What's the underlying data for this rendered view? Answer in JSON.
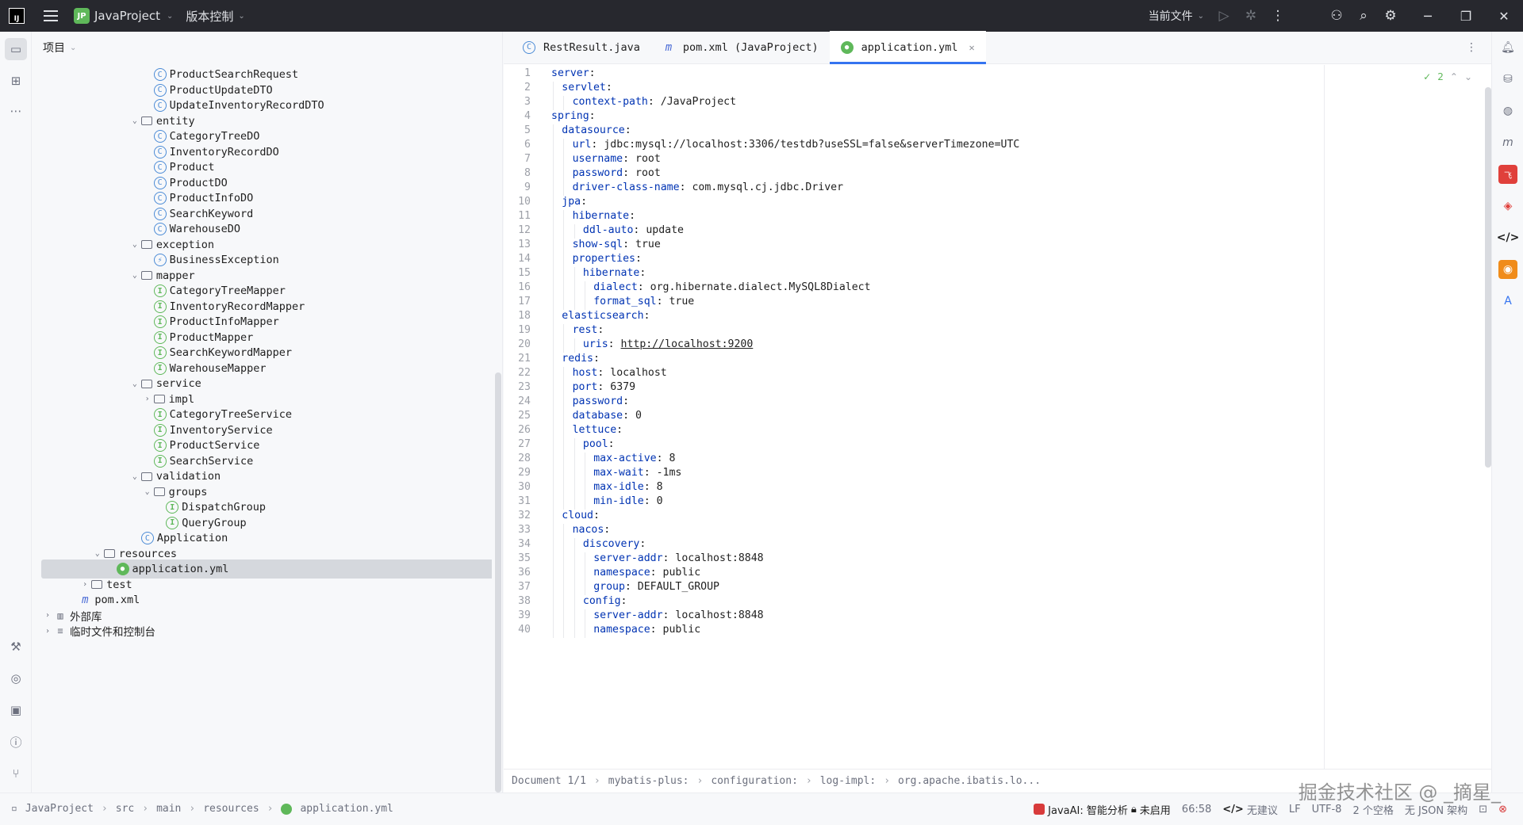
{
  "titlebar": {
    "project_badge": "JP",
    "project_name": "JavaProject",
    "vcs_label": "版本控制",
    "run_config": "当前文件"
  },
  "project_panel": {
    "header": "项目",
    "tree": [
      {
        "label": "ProductSearchRequest",
        "indent": 8,
        "icon": "class",
        "arrow": ""
      },
      {
        "label": "ProductUpdateDTO",
        "indent": 8,
        "icon": "class",
        "arrow": ""
      },
      {
        "label": "UpdateInventoryRecordDTO",
        "indent": 8,
        "icon": "class",
        "arrow": ""
      },
      {
        "label": "entity",
        "indent": 7,
        "icon": "folder",
        "arrow": "open"
      },
      {
        "label": "CategoryTreeDO",
        "indent": 8,
        "icon": "class",
        "arrow": ""
      },
      {
        "label": "InventoryRecordDO",
        "indent": 8,
        "icon": "class",
        "arrow": ""
      },
      {
        "label": "Product",
        "indent": 8,
        "icon": "class",
        "arrow": ""
      },
      {
        "label": "ProductDO",
        "indent": 8,
        "icon": "class",
        "arrow": ""
      },
      {
        "label": "ProductInfoDO",
        "indent": 8,
        "icon": "class",
        "arrow": ""
      },
      {
        "label": "SearchKeyword",
        "indent": 8,
        "icon": "class",
        "arrow": ""
      },
      {
        "label": "WarehouseDO",
        "indent": 8,
        "icon": "class",
        "arrow": ""
      },
      {
        "label": "exception",
        "indent": 7,
        "icon": "folder",
        "arrow": "open"
      },
      {
        "label": "BusinessException",
        "indent": 8,
        "icon": "exception",
        "arrow": ""
      },
      {
        "label": "mapper",
        "indent": 7,
        "icon": "folder",
        "arrow": "open"
      },
      {
        "label": "CategoryTreeMapper",
        "indent": 8,
        "icon": "interface",
        "arrow": ""
      },
      {
        "label": "InventoryRecordMapper",
        "indent": 8,
        "icon": "interface",
        "arrow": ""
      },
      {
        "label": "ProductInfoMapper",
        "indent": 8,
        "icon": "interface",
        "arrow": ""
      },
      {
        "label": "ProductMapper",
        "indent": 8,
        "icon": "interface",
        "arrow": ""
      },
      {
        "label": "SearchKeywordMapper",
        "indent": 8,
        "icon": "interface",
        "arrow": ""
      },
      {
        "label": "WarehouseMapper",
        "indent": 8,
        "icon": "interface",
        "arrow": ""
      },
      {
        "label": "service",
        "indent": 7,
        "icon": "folder",
        "arrow": "open"
      },
      {
        "label": "impl",
        "indent": 8,
        "icon": "folder",
        "arrow": "closed"
      },
      {
        "label": "CategoryTreeService",
        "indent": 8,
        "icon": "interface",
        "arrow": ""
      },
      {
        "label": "InventoryService",
        "indent": 8,
        "icon": "interface",
        "arrow": ""
      },
      {
        "label": "ProductService",
        "indent": 8,
        "icon": "interface",
        "arrow": ""
      },
      {
        "label": "SearchService",
        "indent": 8,
        "icon": "interface",
        "arrow": ""
      },
      {
        "label": "validation",
        "indent": 7,
        "icon": "folder",
        "arrow": "open"
      },
      {
        "label": "groups",
        "indent": 8,
        "icon": "folder",
        "arrow": "open"
      },
      {
        "label": "DispatchGroup",
        "indent": 9,
        "icon": "interface",
        "arrow": ""
      },
      {
        "label": "QueryGroup",
        "indent": 9,
        "icon": "interface",
        "arrow": ""
      },
      {
        "label": "Application",
        "indent": 7,
        "icon": "app",
        "arrow": ""
      },
      {
        "label": "resources",
        "indent": 4,
        "icon": "folder",
        "arrow": "open"
      },
      {
        "label": "application.yml",
        "indent": 5,
        "icon": "yml",
        "arrow": "",
        "selected": true
      },
      {
        "label": "test",
        "indent": 3,
        "icon": "folder",
        "arrow": "closed"
      },
      {
        "label": "pom.xml",
        "indent": 2,
        "icon": "maven",
        "arrow": ""
      },
      {
        "label": "外部库",
        "indent": 0,
        "icon": "lib",
        "arrow": "closed"
      },
      {
        "label": "临时文件和控制台",
        "indent": 0,
        "icon": "scratch",
        "arrow": "closed"
      }
    ]
  },
  "editor": {
    "tabs": [
      {
        "label": "RestResult.java",
        "icon": "class",
        "active": false
      },
      {
        "label": "pom.xml (JavaProject)",
        "icon": "maven",
        "active": false
      },
      {
        "label": "application.yml",
        "icon": "yml",
        "active": true
      }
    ],
    "inspection_count": "2",
    "lines": [
      {
        "n": "1",
        "indent": 0,
        "key": "server",
        "val": ""
      },
      {
        "n": "2",
        "indent": 1,
        "key": "servlet",
        "val": ""
      },
      {
        "n": "3",
        "indent": 2,
        "key": "context-path",
        "val": "/JavaProject"
      },
      {
        "n": "4",
        "indent": 0,
        "key": "spring",
        "val": ""
      },
      {
        "n": "5",
        "indent": 1,
        "key": "datasource",
        "val": ""
      },
      {
        "n": "6",
        "indent": 2,
        "key": "url",
        "val": "jdbc:mysql://localhost:3306/testdb?useSSL=false&serverTimezone=UTC"
      },
      {
        "n": "7",
        "indent": 2,
        "key": "username",
        "val": "root"
      },
      {
        "n": "8",
        "indent": 2,
        "key": "password",
        "val": "root"
      },
      {
        "n": "9",
        "indent": 2,
        "key": "driver-class-name",
        "val": "com.mysql.cj.jdbc.Driver"
      },
      {
        "n": "10",
        "indent": 1,
        "key": "jpa",
        "val": ""
      },
      {
        "n": "11",
        "indent": 2,
        "key": "hibernate",
        "val": ""
      },
      {
        "n": "12",
        "indent": 3,
        "key": "ddl-auto",
        "val": "update"
      },
      {
        "n": "13",
        "indent": 2,
        "key": "show-sql",
        "val": "true"
      },
      {
        "n": "14",
        "indent": 2,
        "key": "properties",
        "val": ""
      },
      {
        "n": "15",
        "indent": 3,
        "key": "hibernate",
        "val": ""
      },
      {
        "n": "16",
        "indent": 4,
        "key": "dialect",
        "val": "org.hibernate.dialect.MySQL8Dialect"
      },
      {
        "n": "17",
        "indent": 4,
        "key": "format_sql",
        "val": "true"
      },
      {
        "n": "18",
        "indent": 1,
        "key": "elasticsearch",
        "val": ""
      },
      {
        "n": "19",
        "indent": 2,
        "key": "rest",
        "val": ""
      },
      {
        "n": "20",
        "indent": 3,
        "key": "uris",
        "val": "http://localhost:9200",
        "url": true
      },
      {
        "n": "21",
        "indent": 1,
        "key": "redis",
        "val": ""
      },
      {
        "n": "22",
        "indent": 2,
        "key": "host",
        "val": "localhost"
      },
      {
        "n": "23",
        "indent": 2,
        "key": "port",
        "val": "6379"
      },
      {
        "n": "24",
        "indent": 2,
        "key": "password",
        "val": ""
      },
      {
        "n": "25",
        "indent": 2,
        "key": "database",
        "val": "0"
      },
      {
        "n": "26",
        "indent": 2,
        "key": "lettuce",
        "val": ""
      },
      {
        "n": "27",
        "indent": 3,
        "key": "pool",
        "val": ""
      },
      {
        "n": "28",
        "indent": 4,
        "key": "max-active",
        "val": "8"
      },
      {
        "n": "29",
        "indent": 4,
        "key": "max-wait",
        "val": "-1ms"
      },
      {
        "n": "30",
        "indent": 4,
        "key": "max-idle",
        "val": "8"
      },
      {
        "n": "31",
        "indent": 4,
        "key": "min-idle",
        "val": "0"
      },
      {
        "n": "32",
        "indent": 1,
        "key": "cloud",
        "val": ""
      },
      {
        "n": "33",
        "indent": 2,
        "key": "nacos",
        "val": ""
      },
      {
        "n": "34",
        "indent": 3,
        "key": "discovery",
        "val": ""
      },
      {
        "n": "35",
        "indent": 4,
        "key": "server-addr",
        "val": "localhost:8848"
      },
      {
        "n": "36",
        "indent": 4,
        "key": "namespace",
        "val": "public"
      },
      {
        "n": "37",
        "indent": 4,
        "key": "group",
        "val": "DEFAULT_GROUP"
      },
      {
        "n": "38",
        "indent": 3,
        "key": "config",
        "val": ""
      },
      {
        "n": "39",
        "indent": 4,
        "key": "server-addr",
        "val": "localhost:8848"
      },
      {
        "n": "40",
        "indent": 4,
        "key": "namespace",
        "val": "public"
      }
    ],
    "breadcrumbs": [
      "Document 1/1",
      "mybatis-plus:",
      "configuration:",
      "log-impl:",
      "org.apache.ibatis.lo..."
    ]
  },
  "statusbar": {
    "path": [
      "JavaProject",
      "src",
      "main",
      "resources",
      "application.yml"
    ],
    "javaai": "JavaAI: 智能分析",
    "disabled": "未启用",
    "position": "66:58",
    "suggestion": "无建议",
    "line_sep": "LF",
    "encoding": "UTF-8",
    "indent": "2 个空格",
    "schema": "无 JSON 架构"
  },
  "watermark": "掘金技术社区 @ _摘星_",
  "colors": {
    "accent": "#3574f0",
    "yaml_key": "#0033b3",
    "yml_icon": "#5fb85a"
  }
}
